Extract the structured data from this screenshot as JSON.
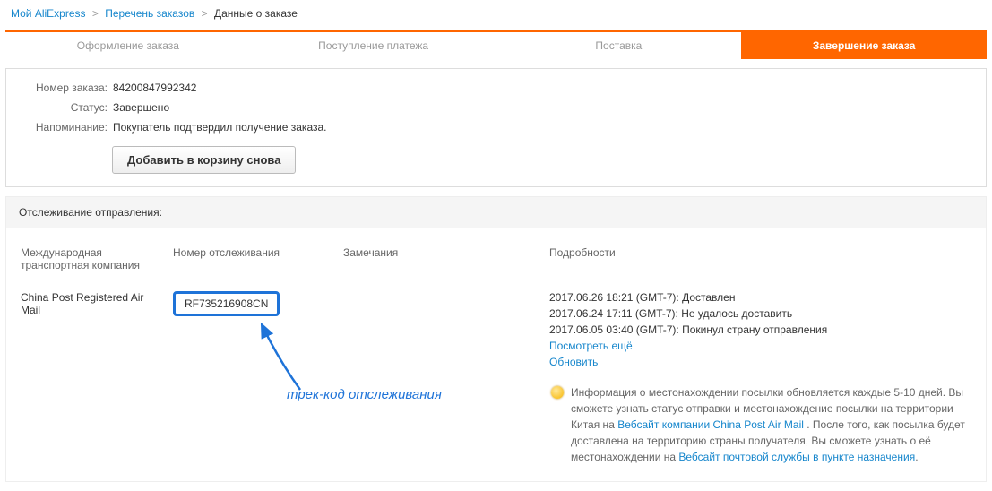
{
  "breadcrumb": {
    "home": "Мой AliExpress",
    "orders": "Перечень заказов",
    "current": "Данные о заказе"
  },
  "steps": [
    "Оформление заказа",
    "Поступление платежа",
    "Поставка",
    "Завершение заказа"
  ],
  "order": {
    "labels": {
      "number": "Номер заказа:",
      "status": "Статус:",
      "reminder": "Напоминание:"
    },
    "number": "84200847992342",
    "status": "Завершено",
    "reminder": "Покупатель подтвердил получение заказа."
  },
  "buttons": {
    "addToCart": "Добавить в корзину снова"
  },
  "tracking": {
    "title": "Отслеживание отправления:",
    "headers": {
      "carrier": "Международная транспортная компания",
      "trackno": "Номер отслеживания",
      "notes": "Замечания",
      "details": "Подробности"
    },
    "carrier": "China Post Registered Air Mail",
    "number": "RF735216908CN",
    "events": [
      "2017.06.26 18:21 (GMT-7): Доставлен",
      "2017.06.24 17:11 (GMT-7): Не удалось доставить",
      "2017.06.05 03:40 (GMT-7): Покинул страну отправления"
    ],
    "more": "Посмотреть ещё",
    "refresh": "Обновить",
    "info1": "Информация о местонахождении посылки обновляется каждые 5-10 дней. Вы сможете узнать статус отправки и местонахождение посылки на территории Китая на ",
    "link1": "Вебсайт компании China Post Air Mail",
    "info2": ". После того, как посылка будет доставлена на территорию страны получателя, Вы сможете узнать о её местонахождении на ",
    "link2": "Вебсайт почтовой службы в пункте назначения",
    "dot": "."
  },
  "annotation": "трек-код отслеживания"
}
